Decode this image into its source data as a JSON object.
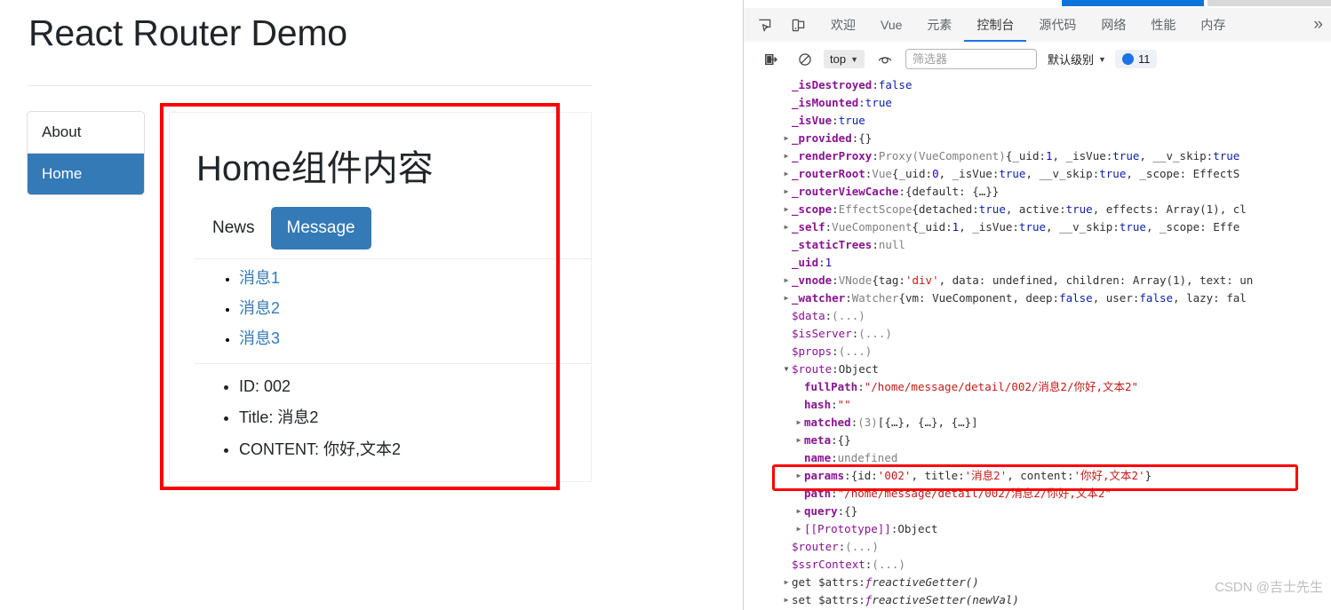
{
  "page": {
    "title": "React Router Demo",
    "nav": [
      {
        "label": "About",
        "active": false
      },
      {
        "label": "Home",
        "active": true
      }
    ],
    "panel": {
      "heading": "Home组件内容",
      "tabs": [
        {
          "label": "News",
          "active": false
        },
        {
          "label": "Message",
          "active": true
        }
      ],
      "messages": [
        {
          "label": "消息1"
        },
        {
          "label": "消息2"
        },
        {
          "label": "消息3"
        }
      ],
      "detail": [
        "ID: 002",
        "Title: 消息2",
        "CONTENT: 你好,文本2"
      ]
    }
  },
  "devtools": {
    "inspect_icon": "inspect-element-icon",
    "device_icon": "device-toolbar-icon",
    "tabs": [
      {
        "label": "欢迎",
        "active": false
      },
      {
        "label": "Vue",
        "active": false
      },
      {
        "label": "元素",
        "active": false
      },
      {
        "label": "控制台",
        "active": true
      },
      {
        "label": "源代码",
        "active": false
      },
      {
        "label": "网络",
        "active": false
      },
      {
        "label": "性能",
        "active": false
      },
      {
        "label": "内存",
        "active": false
      }
    ],
    "more_tabs": "»",
    "toolbar": {
      "clear_icon": "clear-console-icon",
      "no_entry_icon": "no-entry-icon",
      "context": "top",
      "eye_icon": "live-expression-icon",
      "filter_placeholder": "筛选器",
      "filter_value": "",
      "level": "默认级别",
      "message_count": "11"
    },
    "accent_color": "#1a73e8",
    "highlight_color": "#fe0000"
  },
  "console_log": [
    {
      "indent": 0,
      "arrow": "none",
      "parts": [
        {
          "t": "key",
          "v": "_isDestroyed"
        },
        {
          "t": "punct",
          "v": ": "
        },
        {
          "t": "val-bool",
          "v": "false"
        }
      ]
    },
    {
      "indent": 0,
      "arrow": "none",
      "parts": [
        {
          "t": "key",
          "v": "_isMounted"
        },
        {
          "t": "punct",
          "v": ": "
        },
        {
          "t": "val-bool",
          "v": "true"
        }
      ]
    },
    {
      "indent": 0,
      "arrow": "none",
      "parts": [
        {
          "t": "key",
          "v": "_isVue"
        },
        {
          "t": "punct",
          "v": ": "
        },
        {
          "t": "val-bool",
          "v": "true"
        }
      ]
    },
    {
      "indent": 0,
      "arrow": "closed",
      "parts": [
        {
          "t": "key",
          "v": "_provided"
        },
        {
          "t": "punct",
          "v": ": "
        },
        {
          "t": "plain",
          "v": "{}"
        }
      ]
    },
    {
      "indent": 0,
      "arrow": "closed",
      "parts": [
        {
          "t": "key",
          "v": "_renderProxy"
        },
        {
          "t": "punct",
          "v": ": "
        },
        {
          "t": "val-cls",
          "v": "Proxy(VueComponent) "
        },
        {
          "t": "punct",
          "v": "{"
        },
        {
          "t": "plain",
          "v": "_uid: "
        },
        {
          "t": "val-num",
          "v": "1"
        },
        {
          "t": "plain",
          "v": ", _isVue: "
        },
        {
          "t": "val-bool",
          "v": "true"
        },
        {
          "t": "plain",
          "v": ", __v_skip: "
        },
        {
          "t": "val-bool",
          "v": "true"
        }
      ]
    },
    {
      "indent": 0,
      "arrow": "closed",
      "parts": [
        {
          "t": "key",
          "v": "_routerRoot"
        },
        {
          "t": "punct",
          "v": ": "
        },
        {
          "t": "val-cls",
          "v": "Vue "
        },
        {
          "t": "punct",
          "v": "{"
        },
        {
          "t": "plain",
          "v": "_uid: "
        },
        {
          "t": "val-num",
          "v": "0"
        },
        {
          "t": "plain",
          "v": ", _isVue: "
        },
        {
          "t": "val-bool",
          "v": "true"
        },
        {
          "t": "plain",
          "v": ", __v_skip: "
        },
        {
          "t": "val-bool",
          "v": "true"
        },
        {
          "t": "plain",
          "v": ", _scope: EffectS"
        }
      ]
    },
    {
      "indent": 0,
      "arrow": "closed",
      "parts": [
        {
          "t": "key",
          "v": "_routerViewCache"
        },
        {
          "t": "punct",
          "v": ": "
        },
        {
          "t": "plain",
          "v": "{default: {…}}"
        }
      ]
    },
    {
      "indent": 0,
      "arrow": "closed",
      "parts": [
        {
          "t": "key",
          "v": "_scope"
        },
        {
          "t": "punct",
          "v": ": "
        },
        {
          "t": "val-cls",
          "v": "EffectScope "
        },
        {
          "t": "punct",
          "v": "{"
        },
        {
          "t": "plain",
          "v": "detached: "
        },
        {
          "t": "val-bool",
          "v": "true"
        },
        {
          "t": "plain",
          "v": ", active: "
        },
        {
          "t": "val-bool",
          "v": "true"
        },
        {
          "t": "plain",
          "v": ", effects: Array(1), cl"
        }
      ]
    },
    {
      "indent": 0,
      "arrow": "closed",
      "parts": [
        {
          "t": "key",
          "v": "_self"
        },
        {
          "t": "punct",
          "v": ": "
        },
        {
          "t": "val-cls",
          "v": "VueComponent "
        },
        {
          "t": "punct",
          "v": "{"
        },
        {
          "t": "plain",
          "v": "_uid: "
        },
        {
          "t": "val-num",
          "v": "1"
        },
        {
          "t": "plain",
          "v": ", _isVue: "
        },
        {
          "t": "val-bool",
          "v": "true"
        },
        {
          "t": "plain",
          "v": ", __v_skip: "
        },
        {
          "t": "val-bool",
          "v": "true"
        },
        {
          "t": "plain",
          "v": ", _scope: Effe"
        }
      ]
    },
    {
      "indent": 0,
      "arrow": "none",
      "parts": [
        {
          "t": "key",
          "v": "_staticTrees"
        },
        {
          "t": "punct",
          "v": ": "
        },
        {
          "t": "val-null",
          "v": "null"
        }
      ]
    },
    {
      "indent": 0,
      "arrow": "none",
      "parts": [
        {
          "t": "key",
          "v": "_uid"
        },
        {
          "t": "punct",
          "v": ": "
        },
        {
          "t": "val-num",
          "v": "1"
        }
      ]
    },
    {
      "indent": 0,
      "arrow": "closed",
      "parts": [
        {
          "t": "key",
          "v": "_vnode"
        },
        {
          "t": "punct",
          "v": ": "
        },
        {
          "t": "val-cls",
          "v": "VNode "
        },
        {
          "t": "punct",
          "v": "{"
        },
        {
          "t": "plain",
          "v": "tag: "
        },
        {
          "t": "val-str",
          "v": "'div'"
        },
        {
          "t": "plain",
          "v": ", data: undefined, children: Array(1), text: un"
        }
      ]
    },
    {
      "indent": 0,
      "arrow": "closed",
      "parts": [
        {
          "t": "key",
          "v": "_watcher"
        },
        {
          "t": "punct",
          "v": ": "
        },
        {
          "t": "val-cls",
          "v": "Watcher "
        },
        {
          "t": "punct",
          "v": "{"
        },
        {
          "t": "plain",
          "v": "vm: VueComponent, deep: "
        },
        {
          "t": "val-bool",
          "v": "false"
        },
        {
          "t": "plain",
          "v": ", user: "
        },
        {
          "t": "val-bool",
          "v": "false"
        },
        {
          "t": "plain",
          "v": ", lazy: fal"
        }
      ]
    },
    {
      "indent": 0,
      "arrow": "none",
      "parts": [
        {
          "t": "key-p",
          "v": "$data"
        },
        {
          "t": "punct",
          "v": ": "
        },
        {
          "t": "val-grey",
          "v": "(...)"
        }
      ]
    },
    {
      "indent": 0,
      "arrow": "none",
      "parts": [
        {
          "t": "key-p",
          "v": "$isServer"
        },
        {
          "t": "punct",
          "v": ": "
        },
        {
          "t": "val-grey",
          "v": "(...)"
        }
      ]
    },
    {
      "indent": 0,
      "arrow": "none",
      "parts": [
        {
          "t": "key-p",
          "v": "$props"
        },
        {
          "t": "punct",
          "v": ": "
        },
        {
          "t": "val-grey",
          "v": "(...)"
        }
      ]
    },
    {
      "indent": 0,
      "arrow": "open",
      "parts": [
        {
          "t": "key-p",
          "v": "$route"
        },
        {
          "t": "punct",
          "v": ": "
        },
        {
          "t": "plain",
          "v": "Object"
        }
      ]
    },
    {
      "indent": 1,
      "arrow": "none",
      "parts": [
        {
          "t": "key",
          "v": "fullPath"
        },
        {
          "t": "punct",
          "v": ": "
        },
        {
          "t": "val-str",
          "v": "\"/home/message/detail/002/消息2/你好,文本2\""
        }
      ]
    },
    {
      "indent": 1,
      "arrow": "none",
      "parts": [
        {
          "t": "key",
          "v": "hash"
        },
        {
          "t": "punct",
          "v": ": "
        },
        {
          "t": "val-str",
          "v": "\"\""
        }
      ]
    },
    {
      "indent": 1,
      "arrow": "closed",
      "parts": [
        {
          "t": "key",
          "v": "matched"
        },
        {
          "t": "punct",
          "v": ": "
        },
        {
          "t": "val-grey",
          "v": "(3) "
        },
        {
          "t": "plain",
          "v": "[{…}, {…}, {…}]"
        }
      ]
    },
    {
      "indent": 1,
      "arrow": "closed",
      "parts": [
        {
          "t": "key",
          "v": "meta"
        },
        {
          "t": "punct",
          "v": ": "
        },
        {
          "t": "plain",
          "v": "{}"
        }
      ]
    },
    {
      "indent": 1,
      "arrow": "none",
      "parts": [
        {
          "t": "key",
          "v": "name"
        },
        {
          "t": "punct",
          "v": ": "
        },
        {
          "t": "val-grey",
          "v": "undefined"
        }
      ]
    },
    {
      "indent": 1,
      "arrow": "closed",
      "parts": [
        {
          "t": "key",
          "v": "params"
        },
        {
          "t": "punct",
          "v": ": "
        },
        {
          "t": "punct",
          "v": "{"
        },
        {
          "t": "plain",
          "v": "id: "
        },
        {
          "t": "val-str",
          "v": "'002'"
        },
        {
          "t": "plain",
          "v": ", title: "
        },
        {
          "t": "val-str",
          "v": "'消息2'"
        },
        {
          "t": "plain",
          "v": ", content: "
        },
        {
          "t": "val-str",
          "v": "'你好,文本2'"
        },
        {
          "t": "punct",
          "v": "}"
        }
      ]
    },
    {
      "indent": 1,
      "arrow": "none",
      "parts": [
        {
          "t": "key",
          "v": "path"
        },
        {
          "t": "punct",
          "v": ": "
        },
        {
          "t": "val-str",
          "v": "\"/home/message/detail/002/消息2/你好,文本2\""
        }
      ]
    },
    {
      "indent": 1,
      "arrow": "closed",
      "parts": [
        {
          "t": "key",
          "v": "query"
        },
        {
          "t": "punct",
          "v": ": "
        },
        {
          "t": "plain",
          "v": "{}"
        }
      ]
    },
    {
      "indent": 1,
      "arrow": "closed",
      "parts": [
        {
          "t": "key-p",
          "v": "[[Prototype]]"
        },
        {
          "t": "punct",
          "v": ": "
        },
        {
          "t": "plain",
          "v": "Object"
        }
      ]
    },
    {
      "indent": 0,
      "arrow": "none",
      "parts": [
        {
          "t": "key-p",
          "v": "$router"
        },
        {
          "t": "punct",
          "v": ": "
        },
        {
          "t": "val-grey",
          "v": "(...)"
        }
      ]
    },
    {
      "indent": 0,
      "arrow": "none",
      "parts": [
        {
          "t": "key-p",
          "v": "$ssrContext"
        },
        {
          "t": "punct",
          "v": ": "
        },
        {
          "t": "val-grey",
          "v": "(...)"
        }
      ]
    },
    {
      "indent": 0,
      "arrow": "closed",
      "parts": [
        {
          "t": "plain",
          "v": "get $attrs"
        },
        {
          "t": "punct",
          "v": ": "
        },
        {
          "t": "val-fn",
          "v": "ƒ "
        },
        {
          "t": "val-fnname",
          "v": "reactiveGetter()"
        }
      ]
    },
    {
      "indent": 0,
      "arrow": "closed",
      "parts": [
        {
          "t": "plain",
          "v": "set $attrs"
        },
        {
          "t": "punct",
          "v": ": "
        },
        {
          "t": "val-fn",
          "v": "ƒ "
        },
        {
          "t": "val-fnname",
          "v": "reactiveSetter(newVal)"
        }
      ]
    }
  ],
  "watermark": "CSDN @吉士先生"
}
